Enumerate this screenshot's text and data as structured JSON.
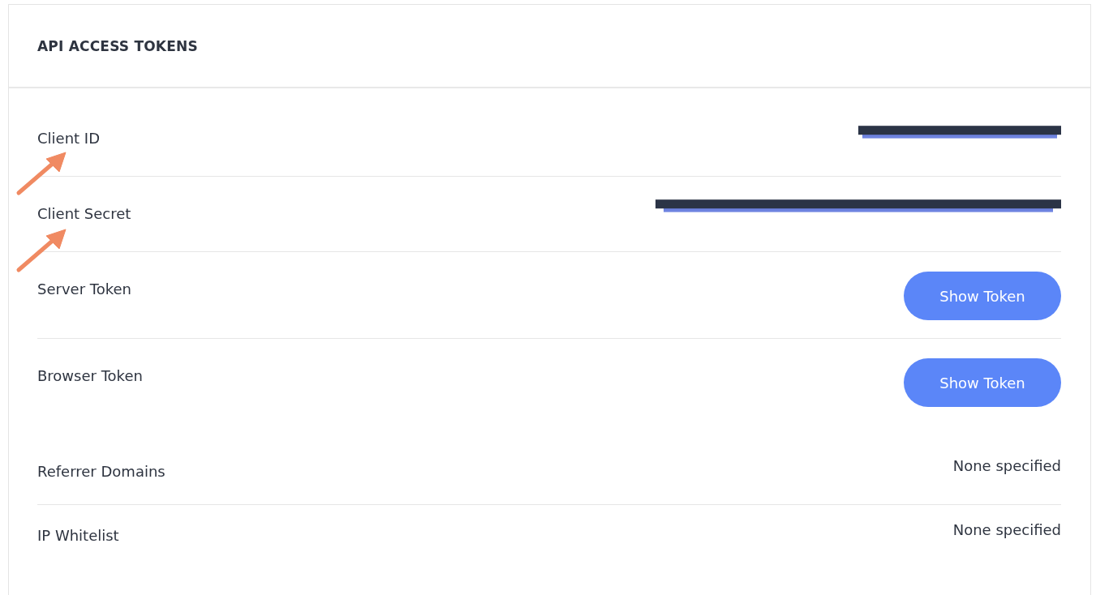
{
  "panel": {
    "title": "API ACCESS TOKENS"
  },
  "rows": [
    {
      "label": "Client ID",
      "kind": "redacted",
      "divider": true
    },
    {
      "label": "Client Secret",
      "kind": "redacted",
      "divider": true
    },
    {
      "label": "Server Token",
      "kind": "button",
      "button": "Show Token",
      "divider": true
    },
    {
      "label": "Browser Token",
      "kind": "button",
      "button": "Show Token",
      "divider": false
    },
    {
      "label": "Referrer Domains",
      "kind": "text",
      "value": "None specified",
      "divider": true
    },
    {
      "label": "IP Whitelist",
      "kind": "text",
      "value": "None specified",
      "divider": false
    }
  ],
  "annotations": [
    {
      "kind": "arrow"
    },
    {
      "kind": "arrow"
    }
  ]
}
